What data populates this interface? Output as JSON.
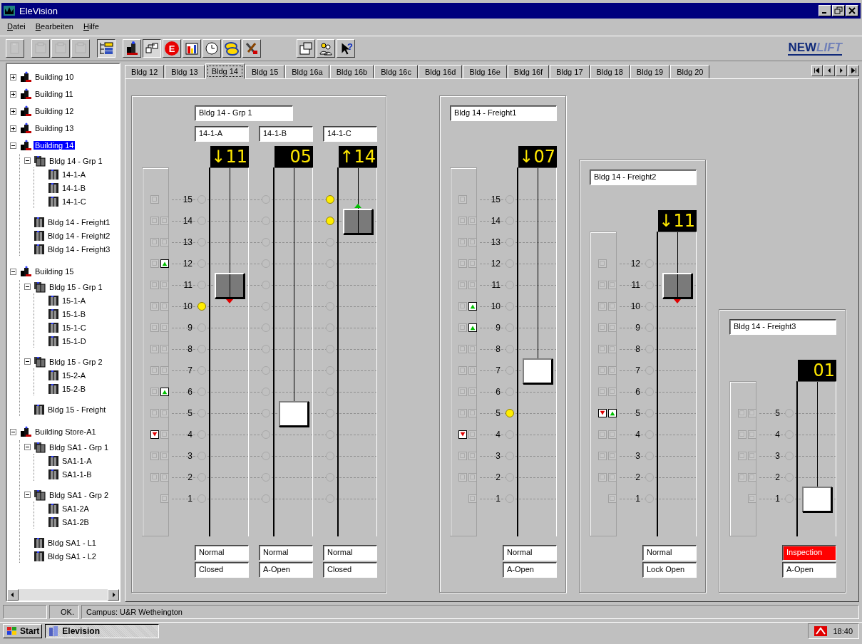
{
  "window": {
    "title": "EleVision"
  },
  "menu": [
    "Datei",
    "Bearbeiten",
    "Hilfe"
  ],
  "toolbar": [
    {
      "items": [
        {
          "kind": "new",
          "disabled": true,
          "pressed": false
        }
      ]
    },
    {
      "items": [
        {
          "kind": "cut",
          "disabled": true,
          "pressed": false
        },
        {
          "kind": "copy",
          "disabled": true,
          "pressed": false
        },
        {
          "kind": "paste",
          "disabled": true,
          "pressed": false
        }
      ]
    },
    {
      "items": [
        {
          "kind": "tree",
          "disabled": false,
          "pressed": true
        }
      ]
    },
    {
      "items": [
        {
          "kind": "building",
          "disabled": false,
          "pressed": false
        },
        {
          "kind": "group",
          "disabled": false,
          "pressed": true
        },
        {
          "kind": "emergency",
          "label": "E",
          "disabled": false,
          "pressed": false
        },
        {
          "kind": "chart",
          "disabled": false,
          "pressed": false
        },
        {
          "kind": "clock",
          "disabled": false,
          "pressed": false
        },
        {
          "kind": "exchange",
          "disabled": false,
          "pressed": false
        },
        {
          "kind": "tools",
          "disabled": false,
          "pressed": false
        }
      ]
    },
    {
      "items": [
        {
          "kind": "properties",
          "disabled": false,
          "pressed": false
        },
        {
          "kind": "people",
          "disabled": false,
          "pressed": false
        },
        {
          "kind": "help",
          "label": "?",
          "disabled": false,
          "pressed": false
        }
      ]
    }
  ],
  "logo": {
    "first": "NEW",
    "second": "LIFT"
  },
  "tree": [
    {
      "label": "Building 10",
      "kind": "building",
      "expanded": false,
      "selected": false
    },
    {
      "label": "Building 11",
      "kind": "building",
      "expanded": false,
      "selected": false
    },
    {
      "label": "Building 12",
      "kind": "building",
      "expanded": false,
      "selected": false
    },
    {
      "label": "Building 13",
      "kind": "building",
      "expanded": false,
      "selected": false
    },
    {
      "label": "Building 14",
      "kind": "building",
      "expanded": true,
      "selected": true,
      "children": [
        {
          "label": "Bldg 14 - Grp 1",
          "kind": "group",
          "expanded": true,
          "selected": false,
          "children": [
            {
              "label": "14-1-A",
              "kind": "car",
              "selected": false
            },
            {
              "label": "14-1-B",
              "kind": "car",
              "selected": false
            },
            {
              "label": "14-1-C",
              "kind": "car",
              "selected": false
            }
          ]
        },
        {
          "label": "Bldg 14 - Freight1",
          "kind": "car",
          "selected": false
        },
        {
          "label": "Bldg 14 - Freight2",
          "kind": "car",
          "selected": false
        },
        {
          "label": "Bldg 14 - Freight3",
          "kind": "car",
          "selected": false
        }
      ]
    },
    {
      "label": "Building 15",
      "kind": "building",
      "expanded": true,
      "selected": false,
      "children": [
        {
          "label": "Bldg 15 - Grp 1",
          "kind": "group",
          "expanded": true,
          "selected": false,
          "children": [
            {
              "label": "15-1-A",
              "kind": "car",
              "selected": false
            },
            {
              "label": "15-1-B",
              "kind": "car",
              "selected": false
            },
            {
              "label": "15-1-C",
              "kind": "car",
              "selected": false
            },
            {
              "label": "15-1-D",
              "kind": "car",
              "selected": false
            }
          ]
        },
        {
          "label": "Bldg 15 - Grp 2",
          "kind": "group",
          "expanded": true,
          "selected": false,
          "children": [
            {
              "label": "15-2-A",
              "kind": "car",
              "selected": false
            },
            {
              "label": "15-2-B",
              "kind": "car",
              "selected": false
            }
          ]
        },
        {
          "label": "Bldg 15 - Freight",
          "kind": "car",
          "selected": false
        }
      ]
    },
    {
      "label": "Building Store-A1",
      "kind": "building",
      "expanded": true,
      "selected": false,
      "children": [
        {
          "label": "Bldg SA1 - Grp 1",
          "kind": "group",
          "expanded": true,
          "selected": false,
          "children": [
            {
              "label": "SA1-1-A",
              "kind": "car",
              "selected": false
            },
            {
              "label": "SA1-1-B",
              "kind": "car",
              "selected": false
            }
          ]
        },
        {
          "label": "Bldg SA1 - Grp 2",
          "kind": "group",
          "expanded": true,
          "selected": false,
          "children": [
            {
              "label": "SA1-2A",
              "kind": "car",
              "selected": false
            },
            {
              "label": "SA1-2B",
              "kind": "car",
              "selected": false
            }
          ]
        },
        {
          "label": "Bldg SA1 - L1",
          "kind": "car",
          "selected": false
        },
        {
          "label": "Bldg SA1 - L2",
          "kind": "car",
          "selected": false
        }
      ]
    }
  ],
  "tabs": [
    {
      "label": "Bldg 12",
      "selected": false
    },
    {
      "label": "Bldg 13",
      "selected": false
    },
    {
      "label": "Bldg 14",
      "selected": true
    },
    {
      "label": "Bldg 15",
      "selected": false
    },
    {
      "label": "Bldg 16a",
      "selected": false
    },
    {
      "label": "Bldg 16b",
      "selected": false
    },
    {
      "label": "Bldg 16c",
      "selected": false
    },
    {
      "label": "Bldg 16d",
      "selected": false
    },
    {
      "label": "Bldg 16e",
      "selected": false
    },
    {
      "label": "Bldg 16f",
      "selected": false
    },
    {
      "label": "Bldg 17",
      "selected": false
    },
    {
      "label": "Bldg 18",
      "selected": false
    },
    {
      "label": "Bldg 19",
      "selected": false
    },
    {
      "label": "Bldg 20",
      "selected": false
    }
  ],
  "panels": [
    {
      "kind": "group",
      "title": "Bldg 14 - Grp 1",
      "landings": [
        {
          "label": "15",
          "buttons": [
            {
              "kind": "down",
              "on": false
            }
          ]
        },
        {
          "label": "14",
          "buttons": [
            {
              "kind": "down",
              "on": false
            },
            {
              "kind": "up",
              "on": false
            }
          ]
        },
        {
          "label": "13",
          "buttons": [
            {
              "kind": "down",
              "on": false
            },
            {
              "kind": "up",
              "on": false
            }
          ]
        },
        {
          "label": "12",
          "buttons": [
            {
              "kind": "down",
              "on": false
            },
            {
              "kind": "up",
              "on": true
            }
          ]
        },
        {
          "label": "11",
          "buttons": [
            {
              "kind": "down",
              "on": false
            },
            {
              "kind": "up",
              "on": false
            }
          ]
        },
        {
          "label": "10",
          "buttons": [
            {
              "kind": "down",
              "on": false
            },
            {
              "kind": "up",
              "on": false
            }
          ]
        },
        {
          "label": "9",
          "buttons": [
            {
              "kind": "down",
              "on": false
            },
            {
              "kind": "up",
              "on": false
            }
          ]
        },
        {
          "label": "8",
          "buttons": [
            {
              "kind": "down",
              "on": false
            },
            {
              "kind": "up",
              "on": false
            }
          ]
        },
        {
          "label": "7",
          "buttons": [
            {
              "kind": "down",
              "on": false
            },
            {
              "kind": "up",
              "on": false
            }
          ]
        },
        {
          "label": "6",
          "buttons": [
            {
              "kind": "down",
              "on": false
            },
            {
              "kind": "up",
              "on": true
            }
          ]
        },
        {
          "label": "5",
          "buttons": [
            {
              "kind": "down",
              "on": false
            },
            {
              "kind": "up",
              "on": false
            }
          ]
        },
        {
          "label": "4",
          "buttons": [
            {
              "kind": "down",
              "on": true
            },
            {
              "kind": "up",
              "on": false
            }
          ]
        },
        {
          "label": "3",
          "buttons": [
            {
              "kind": "down",
              "on": false
            },
            {
              "kind": "up",
              "on": false
            }
          ]
        },
        {
          "label": "2",
          "buttons": [
            {
              "kind": "down",
              "on": false
            },
            {
              "kind": "up",
              "on": false
            }
          ]
        },
        {
          "label": "1",
          "buttons": [
            {
              "kind": "up",
              "on": false
            }
          ]
        }
      ],
      "cars": [
        {
          "name": "14-1-A",
          "display": "↓11",
          "doors_open": false,
          "moving_up": false,
          "moving_down": true,
          "mode": "Normal",
          "alert": false,
          "door_status": "Closed",
          "stops": [
            {
              "car": false,
              "call": false
            },
            {
              "car": false,
              "call": false
            },
            {
              "car": false,
              "call": false
            },
            {
              "car": false,
              "call": false
            },
            {
              "car": true,
              "call": false
            },
            {
              "car": false,
              "call": true
            },
            {
              "car": false,
              "call": false
            },
            {
              "car": false,
              "call": false
            },
            {
              "car": false,
              "call": false
            },
            {
              "car": false,
              "call": false
            },
            {
              "car": false,
              "call": false
            },
            {
              "car": false,
              "call": false
            },
            {
              "car": false,
              "call": false
            },
            {
              "car": false,
              "call": false
            },
            {
              "car": false,
              "call": false
            }
          ]
        },
        {
          "name": "14-1-B",
          "display": "05",
          "doors_open": true,
          "moving_up": false,
          "moving_down": false,
          "mode": "Normal",
          "alert": false,
          "door_status": "A-Open",
          "stops": [
            {
              "car": false,
              "call": false
            },
            {
              "car": false,
              "call": false
            },
            {
              "car": false,
              "call": false
            },
            {
              "car": false,
              "call": false
            },
            {
              "car": false,
              "call": false
            },
            {
              "car": false,
              "call": false
            },
            {
              "car": false,
              "call": false
            },
            {
              "car": false,
              "call": false
            },
            {
              "car": false,
              "call": false
            },
            {
              "car": false,
              "call": false
            },
            {
              "car": true,
              "call": false
            },
            {
              "car": false,
              "call": false
            },
            {
              "car": false,
              "call": false
            },
            {
              "car": false,
              "call": false
            },
            {
              "car": false,
              "call": false
            }
          ]
        },
        {
          "name": "14-1-C",
          "display": "↑14",
          "doors_open": false,
          "moving_up": true,
          "moving_down": false,
          "mode": "Normal",
          "alert": false,
          "door_status": "Closed",
          "stops": [
            {
              "car": false,
              "call": true
            },
            {
              "car": true,
              "call": true
            },
            {
              "car": false,
              "call": false
            },
            {
              "car": false,
              "call": false
            },
            {
              "car": false,
              "call": false
            },
            {
              "car": false,
              "call": false
            },
            {
              "car": false,
              "call": false
            },
            {
              "car": false,
              "call": false
            },
            {
              "car": false,
              "call": false
            },
            {
              "car": false,
              "call": false
            },
            {
              "car": false,
              "call": false
            },
            {
              "car": false,
              "call": false
            },
            {
              "car": false,
              "call": false
            },
            {
              "car": false,
              "call": false
            },
            {
              "car": false,
              "call": false
            }
          ]
        }
      ]
    },
    {
      "kind": "single",
      "title": "Bldg 14 - Freight1",
      "landings": [
        {
          "label": "15",
          "buttons": [
            {
              "kind": "down",
              "on": false
            }
          ]
        },
        {
          "label": "14",
          "buttons": [
            {
              "kind": "down",
              "on": false
            },
            {
              "kind": "up",
              "on": false
            }
          ]
        },
        {
          "label": "13",
          "buttons": [
            {
              "kind": "down",
              "on": false
            },
            {
              "kind": "up",
              "on": false
            }
          ]
        },
        {
          "label": "12",
          "buttons": [
            {
              "kind": "down",
              "on": false
            },
            {
              "kind": "up",
              "on": false
            }
          ]
        },
        {
          "label": "11",
          "buttons": [
            {
              "kind": "down",
              "on": false
            },
            {
              "kind": "up",
              "on": false
            }
          ]
        },
        {
          "label": "10",
          "buttons": [
            {
              "kind": "down",
              "on": false
            },
            {
              "kind": "up",
              "on": true
            }
          ]
        },
        {
          "label": "9",
          "buttons": [
            {
              "kind": "down",
              "on": false
            },
            {
              "kind": "up",
              "on": true
            }
          ]
        },
        {
          "label": "8",
          "buttons": [
            {
              "kind": "down",
              "on": false
            },
            {
              "kind": "up",
              "on": false
            }
          ]
        },
        {
          "label": "7",
          "buttons": [
            {
              "kind": "down",
              "on": false
            },
            {
              "kind": "up",
              "on": false
            }
          ]
        },
        {
          "label": "6",
          "buttons": [
            {
              "kind": "down",
              "on": false
            },
            {
              "kind": "up",
              "on": false
            }
          ]
        },
        {
          "label": "5",
          "buttons": [
            {
              "kind": "down",
              "on": false
            },
            {
              "kind": "up",
              "on": false
            }
          ]
        },
        {
          "label": "4",
          "buttons": [
            {
              "kind": "down",
              "on": true
            },
            {
              "kind": "up",
              "on": false
            }
          ]
        },
        {
          "label": "3",
          "buttons": [
            {
              "kind": "down",
              "on": false
            },
            {
              "kind": "up",
              "on": false
            }
          ]
        },
        {
          "label": "2",
          "buttons": [
            {
              "kind": "down",
              "on": false
            },
            {
              "kind": "up",
              "on": false
            }
          ]
        },
        {
          "label": "1",
          "buttons": [
            {
              "kind": "up",
              "on": false
            }
          ]
        }
      ],
      "cars": [
        {
          "display": "↓07",
          "doors_open": true,
          "moving_up": false,
          "moving_down": false,
          "mode": "Normal",
          "alert": false,
          "door_status": "A-Open",
          "stops": [
            {
              "car": false,
              "call": false
            },
            {
              "car": false,
              "call": false
            },
            {
              "car": false,
              "call": false
            },
            {
              "car": false,
              "call": false
            },
            {
              "car": false,
              "call": false
            },
            {
              "car": false,
              "call": false
            },
            {
              "car": false,
              "call": false
            },
            {
              "car": false,
              "call": false
            },
            {
              "car": true,
              "call": false
            },
            {
              "car": false,
              "call": false
            },
            {
              "car": false,
              "call": true
            },
            {
              "car": false,
              "call": false
            },
            {
              "car": false,
              "call": false
            },
            {
              "car": false,
              "call": false
            },
            {
              "car": false,
              "call": false
            }
          ]
        }
      ]
    },
    {
      "kind": "single",
      "title": "Bldg 14 - Freight2",
      "landings": [
        {
          "label": "12",
          "buttons": [
            {
              "kind": "down",
              "on": false
            }
          ]
        },
        {
          "label": "11",
          "buttons": [
            {
              "kind": "down",
              "on": false
            },
            {
              "kind": "up",
              "on": false
            }
          ]
        },
        {
          "label": "10",
          "buttons": [
            {
              "kind": "down",
              "on": false
            },
            {
              "kind": "up",
              "on": false
            }
          ]
        },
        {
          "label": "9",
          "buttons": [
            {
              "kind": "down",
              "on": false
            },
            {
              "kind": "up",
              "on": false
            }
          ]
        },
        {
          "label": "8",
          "buttons": [
            {
              "kind": "down",
              "on": false
            },
            {
              "kind": "up",
              "on": false
            }
          ]
        },
        {
          "label": "7",
          "buttons": [
            {
              "kind": "down",
              "on": false
            },
            {
              "kind": "up",
              "on": false
            }
          ]
        },
        {
          "label": "6",
          "buttons": [
            {
              "kind": "down",
              "on": false
            },
            {
              "kind": "up",
              "on": false
            }
          ]
        },
        {
          "label": "5",
          "buttons": [
            {
              "kind": "down",
              "on": true
            },
            {
              "kind": "up",
              "on": true
            }
          ]
        },
        {
          "label": "4",
          "buttons": [
            {
              "kind": "down",
              "on": false
            },
            {
              "kind": "up",
              "on": false
            }
          ]
        },
        {
          "label": "3",
          "buttons": [
            {
              "kind": "down",
              "on": false
            },
            {
              "kind": "up",
              "on": false
            }
          ]
        },
        {
          "label": "2",
          "buttons": [
            {
              "kind": "down",
              "on": false
            },
            {
              "kind": "up",
              "on": false
            }
          ]
        },
        {
          "label": "1",
          "buttons": [
            {
              "kind": "up",
              "on": false
            }
          ]
        }
      ],
      "cars": [
        {
          "display": "↓11",
          "doors_open": false,
          "moving_up": false,
          "moving_down": true,
          "mode": "Normal",
          "alert": false,
          "door_status": "Lock Open",
          "stops": [
            {
              "car": false,
              "call": false
            },
            {
              "car": true,
              "call": false
            },
            {
              "car": false,
              "call": false
            },
            {
              "car": false,
              "call": false
            },
            {
              "car": false,
              "call": false
            },
            {
              "car": false,
              "call": false
            },
            {
              "car": false,
              "call": false
            },
            {
              "car": false,
              "call": false
            },
            {
              "car": false,
              "call": false
            },
            {
              "car": false,
              "call": false
            },
            {
              "car": false,
              "call": false
            },
            {
              "car": false,
              "call": false
            }
          ]
        }
      ]
    },
    {
      "kind": "single",
      "title": "Bldg 14 - Freight3",
      "landings": [
        {
          "label": "5",
          "buttons": [
            {
              "kind": "down",
              "on": false
            },
            {
              "kind": "up",
              "on": false
            }
          ]
        },
        {
          "label": "4",
          "buttons": [
            {
              "kind": "down",
              "on": false
            },
            {
              "kind": "up",
              "on": false
            }
          ]
        },
        {
          "label": "3",
          "buttons": [
            {
              "kind": "down",
              "on": false
            },
            {
              "kind": "up",
              "on": false
            }
          ]
        },
        {
          "label": "2",
          "buttons": [
            {
              "kind": "down",
              "on": false
            },
            {
              "kind": "up",
              "on": false
            }
          ]
        },
        {
          "label": "1",
          "buttons": [
            {
              "kind": "up",
              "on": false
            }
          ]
        }
      ],
      "cars": [
        {
          "display": "01",
          "doors_open": true,
          "moving_up": false,
          "moving_down": false,
          "mode": "Inspection",
          "alert": true,
          "door_status": "A-Open",
          "stops": [
            {
              "car": false,
              "call": false
            },
            {
              "car": false,
              "call": false
            },
            {
              "car": false,
              "call": false
            },
            {
              "car": false,
              "call": false
            },
            {
              "car": true,
              "call": false
            }
          ]
        }
      ]
    }
  ],
  "status_bar": [
    "OK.",
    "Campus: U&R Wetheington"
  ],
  "taskbar": {
    "start": "Start",
    "task": "Elevision",
    "clock": "18:40"
  }
}
